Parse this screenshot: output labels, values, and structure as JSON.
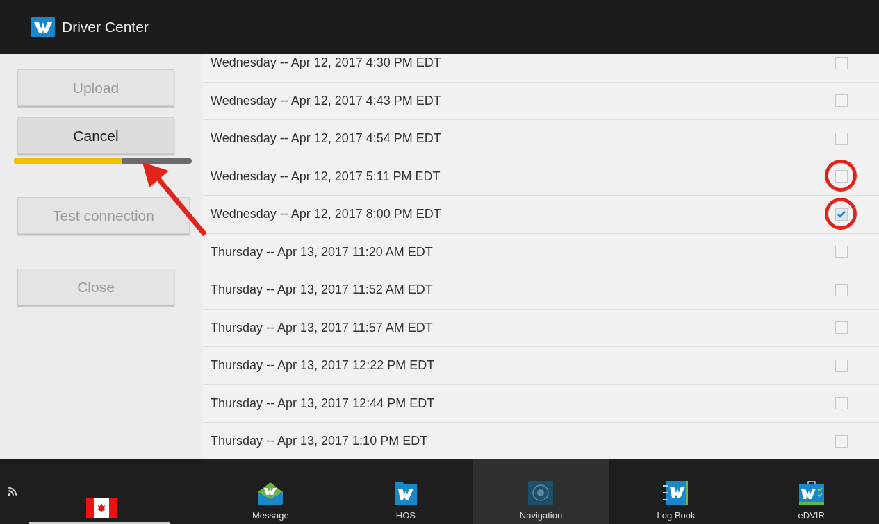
{
  "header": {
    "title": "Driver Center"
  },
  "actions": [
    {
      "label": "Upload",
      "disabled": true
    },
    {
      "label": "Cancel",
      "disabled": false
    },
    {
      "kind": "progress",
      "level": 0.61
    },
    {
      "label": "Test connection",
      "disabled": true
    },
    {
      "label": "Close",
      "disabled": true
    }
  ],
  "log_rows": [
    {
      "text": "Wednesday -- Apr 12, 2017 4:30 PM EDT",
      "checked": false,
      "circled": false
    },
    {
      "text": "Wednesday -- Apr 12, 2017 4:43 PM EDT",
      "checked": false,
      "circled": false
    },
    {
      "text": "Wednesday -- Apr 12, 2017 4:54 PM EDT",
      "checked": false,
      "circled": false
    },
    {
      "text": "Wednesday -- Apr 12, 2017 5:11 PM EDT",
      "checked": false,
      "circled": true
    },
    {
      "text": "Wednesday -- Apr 12, 2017 8:00 PM EDT",
      "checked": true,
      "circled": true
    },
    {
      "text": "Thursday -- Apr 13, 2017 11:20 AM EDT",
      "checked": false,
      "circled": false
    },
    {
      "text": "Thursday -- Apr 13, 2017 11:52 AM EDT",
      "checked": false,
      "circled": false
    },
    {
      "text": "Thursday -- Apr 13, 2017 11:57 AM EDT",
      "checked": false,
      "circled": false
    },
    {
      "text": "Thursday -- Apr 13, 2017 12:22 PM EDT",
      "checked": false,
      "circled": false
    },
    {
      "text": "Thursday -- Apr 13, 2017 12:44 PM EDT",
      "checked": false,
      "circled": false
    },
    {
      "text": "Thursday -- Apr 13, 2017 1:10 PM EDT",
      "checked": false,
      "circled": false
    }
  ],
  "nav_tabs": [
    {
      "label": "Message",
      "kind": "message",
      "selected": false
    },
    {
      "label": "HOS",
      "kind": "hos",
      "selected": false
    },
    {
      "label": "Navigation",
      "kind": "navigation",
      "selected": true
    },
    {
      "label": "Log Book",
      "kind": "logbook",
      "selected": false
    },
    {
      "label": "eDVIR",
      "kind": "edvir",
      "selected": false
    }
  ]
}
